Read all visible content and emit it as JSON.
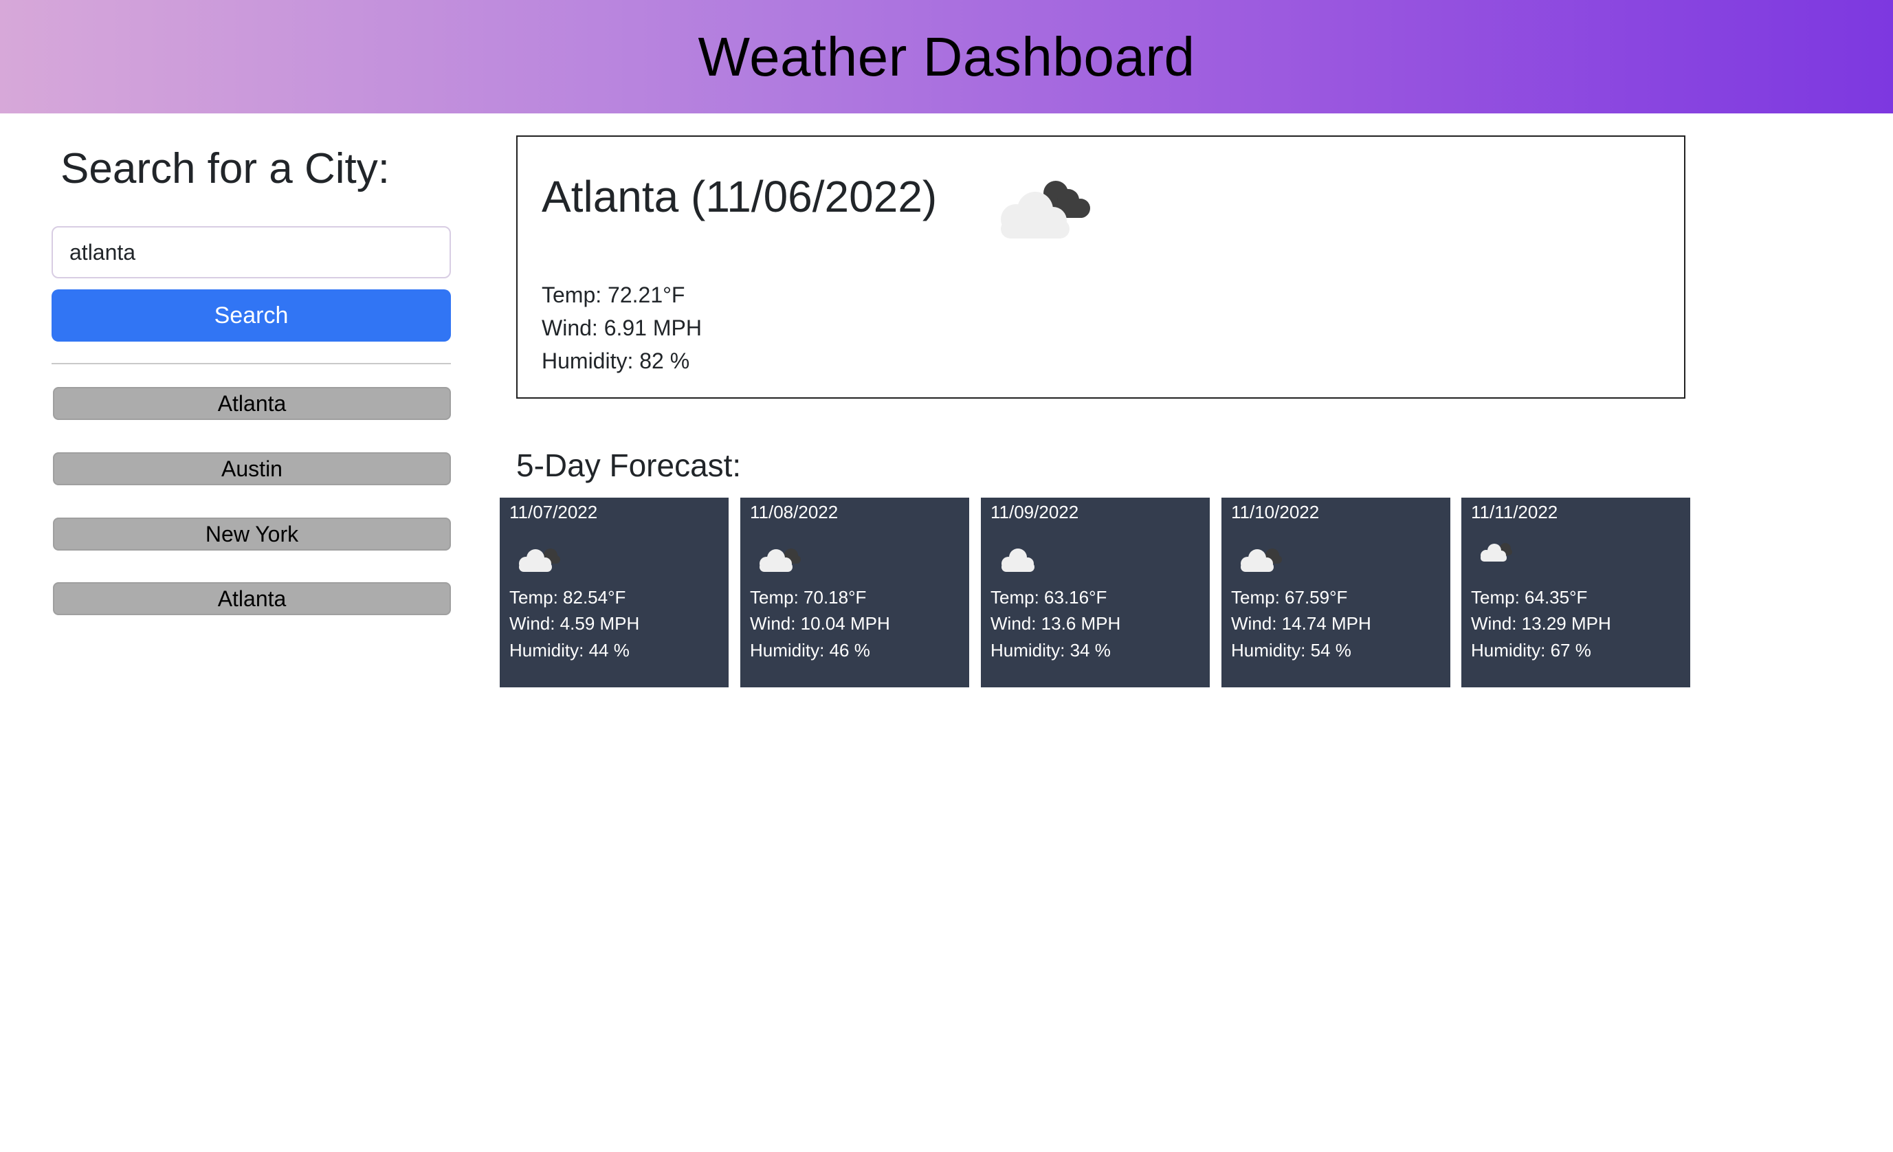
{
  "header": {
    "title": "Weather Dashboard"
  },
  "search": {
    "heading": "Search for a City:",
    "input_value": "atlanta",
    "button_label": "Search"
  },
  "history": [
    {
      "label": "Atlanta"
    },
    {
      "label": "Austin"
    },
    {
      "label": "New York"
    },
    {
      "label": "Atlanta"
    }
  ],
  "current": {
    "title": "Atlanta (11/06/2022)",
    "icon": "cloudy-night-icon",
    "temp": "Temp: 72.21°F",
    "wind": "Wind: 6.91 MPH",
    "humidity": "Humidity: 82 %"
  },
  "forecast": {
    "heading": "5-Day Forecast:",
    "days": [
      {
        "date": "11/07/2022",
        "icon": "cloudy-night-icon",
        "temp": "Temp: 82.54°F",
        "wind": "Wind: 4.59 MPH",
        "humidity": "Humidity: 44 %"
      },
      {
        "date": "11/08/2022",
        "icon": "cloudy-night-icon",
        "temp": "Temp: 70.18°F",
        "wind": "Wind: 10.04 MPH",
        "humidity": "Humidity: 46 %"
      },
      {
        "date": "11/09/2022",
        "icon": "cloud-icon",
        "temp": "Temp: 63.16°F",
        "wind": "Wind: 13.6 MPH",
        "humidity": "Humidity: 34 %"
      },
      {
        "date": "11/10/2022",
        "icon": "cloudy-night-icon",
        "temp": "Temp: 67.59°F",
        "wind": "Wind: 14.74 MPH",
        "humidity": "Humidity: 54 %"
      },
      {
        "date": "11/11/2022",
        "icon": "cloudy-night-icon",
        "temp": "Temp: 64.35°F",
        "wind": "Wind: 13.29 MPH",
        "humidity": "Humidity: 67 %"
      }
    ]
  },
  "colors": {
    "header_gradient_start": "#d7a8d9",
    "header_gradient_end": "#7d38e0",
    "search_button": "#3175f4",
    "history_button": "#acacac",
    "forecast_card": "#343d4e"
  }
}
